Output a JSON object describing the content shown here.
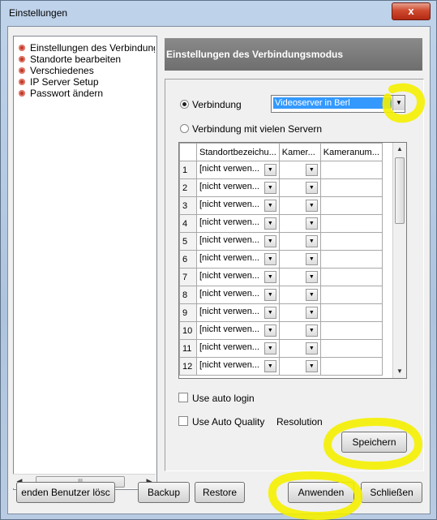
{
  "window": {
    "title": "Einstellungen",
    "close_label": "x"
  },
  "tree": {
    "items": [
      "Einstellungen des Verbindungsmodus",
      "Standorte bearbeiten",
      "Verschiedenes",
      "IP Server Setup",
      "Passwort ändern"
    ],
    "scroll_thumb": "III"
  },
  "panel": {
    "header": "Einstellungen des Verbindungsmodus",
    "radio_single": "Verbindung",
    "radio_multi": "Verbindung mit vielen Servern",
    "server_select": "Videoserver in Berl",
    "columns": [
      "",
      "Standortbezeichu...",
      "Kamer...",
      "Kameranum..."
    ],
    "rows": [
      {
        "n": "1",
        "site": "[nicht verwen..."
      },
      {
        "n": "2",
        "site": "[nicht verwen..."
      },
      {
        "n": "3",
        "site": "[nicht verwen..."
      },
      {
        "n": "4",
        "site": "[nicht verwen..."
      },
      {
        "n": "5",
        "site": "[nicht verwen..."
      },
      {
        "n": "6",
        "site": "[nicht verwen..."
      },
      {
        "n": "7",
        "site": "[nicht verwen..."
      },
      {
        "n": "8",
        "site": "[nicht verwen..."
      },
      {
        "n": "9",
        "site": "[nicht verwen..."
      },
      {
        "n": "10",
        "site": "[nicht verwen..."
      },
      {
        "n": "11",
        "site": "[nicht verwen..."
      },
      {
        "n": "12",
        "site": "[nicht verwen..."
      }
    ],
    "use_auto_login": "Use auto login",
    "use_auto_quality": "Use Auto Quality",
    "resolution": "Resolution",
    "save_label": "Speichern"
  },
  "footer": {
    "delete_user": "enden Benutzer lösc",
    "backup": "Backup",
    "restore": "Restore",
    "apply": "Anwenden",
    "close": "Schließen"
  },
  "colors": {
    "highlight_yellow": "#f5f000",
    "selection_blue": "#3399ff",
    "header_gray": "#7a7a7a"
  }
}
